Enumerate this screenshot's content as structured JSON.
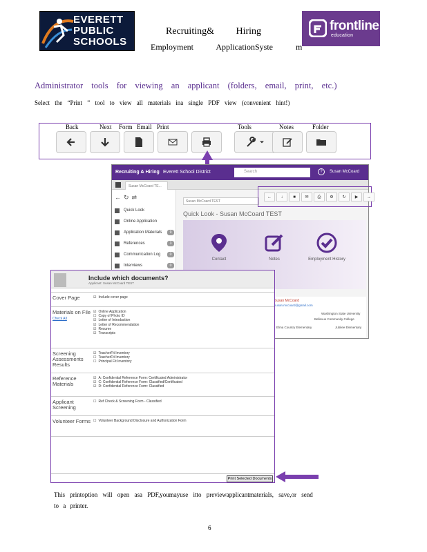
{
  "header": {
    "eps_logo": [
      "EVERETT",
      "PUBLIC",
      "SCHOOLS"
    ],
    "frontline_logo": {
      "word": "frontline",
      "sub": "education",
      "color": "#6b3b8e"
    },
    "title_line1": "Recruiting& Hiring",
    "title_line2": "Employment ApplicationSyste m"
  },
  "heading": "Administrator tools for viewing an applicant (folders, email, print, etc.)",
  "instruction": "Select the “Print ” tool to view all materials ina single PDF view (convenient hint!)",
  "toolbar": {
    "labels": [
      "Back",
      "Next",
      "Form",
      "Email",
      "Print",
      "Tools",
      "Notes",
      "Folder"
    ],
    "buttons": [
      "arrow-left-icon",
      "arrow-down-icon",
      "document-icon",
      "envelope-icon",
      "printer-icon",
      "wrench-icon",
      "edit-icon",
      "folder-icon"
    ],
    "accent": "#7a3fae"
  },
  "app": {
    "title": "Recruiting & Hiring",
    "district": "Everett School District",
    "search_placeholder": "Search",
    "user": "Susan McCoard",
    "tab": "Susan McCoard TE...",
    "applicant_name": "Susan McCoard TEST",
    "quick_look": "Quick Look - Susan McCoard TEST",
    "sidebar": [
      {
        "label": "Quick Look",
        "count": ""
      },
      {
        "label": "Online Application",
        "count": ""
      },
      {
        "label": "Application Materials",
        "count": "9"
      },
      {
        "label": "References",
        "count": "3"
      },
      {
        "label": "Communication Log",
        "count": "0"
      },
      {
        "label": "Interviews",
        "count": "0"
      }
    ],
    "panel_icons": [
      "Contact",
      "Notes",
      "Employment History"
    ],
    "doc_name": "Susan McCoard",
    "doc_email": "susan.mccoard@gmail.com",
    "doc_line1": "Washington State University",
    "doc_line2": "Bellevue Community College",
    "doc_line3": "Elma Country Elementary",
    "doc_line4": "Jubilee Elementary"
  },
  "dialog": {
    "title": "Include which documents?",
    "subtitle": "Applicant: Susan McCoard TEST",
    "sections": [
      {
        "label": "Cover Page",
        "link": "",
        "options": [
          {
            "t": "Include cover page",
            "c": true
          }
        ]
      },
      {
        "label": "Materials on File",
        "link": "Check All",
        "options": [
          {
            "t": "Online Application",
            "c": true
          },
          {
            "t": "Copy of Photo ID",
            "c": false
          },
          {
            "t": "Letter of Introduction",
            "c": true
          },
          {
            "t": "Letter of Recommendation",
            "c": true
          },
          {
            "t": "Resume",
            "c": true
          },
          {
            "t": "Transcripts",
            "c": true
          }
        ]
      },
      {
        "label": "Screening Assessments Results",
        "link": "",
        "options": [
          {
            "t": "TeacherFit Inventory",
            "c": true
          },
          {
            "t": "TeacherFit Inventory",
            "c": false
          },
          {
            "t": "Principal Fit Inventory",
            "c": false
          }
        ]
      },
      {
        "label": "Reference Materials",
        "link": "",
        "options": [
          {
            "t": "A: Confidential Reference Form: Certificated Administrator",
            "c": true
          },
          {
            "t": "C: Confidential Reference Form: Classified/Certificated",
            "c": true
          },
          {
            "t": "D: Confidential Reference Form: Classified",
            "c": true
          }
        ]
      },
      {
        "label": "Applicant Screening",
        "link": "",
        "options": [
          {
            "t": "Ref Check & Screening Form - Classified",
            "c": false
          }
        ]
      },
      {
        "label": "Volunteer Forms",
        "link": "",
        "options": [
          {
            "t": "Volunteer Background Disclosure and Authorization Form",
            "c": false
          }
        ]
      }
    ],
    "print_button": "Print Selected Documents"
  },
  "bottom_line1": "This printoption will open asa PDF,youmayuse itto previewapplicantmaterials, save,or send",
  "bottom_line2": "to a printer.",
  "page_number": "6"
}
